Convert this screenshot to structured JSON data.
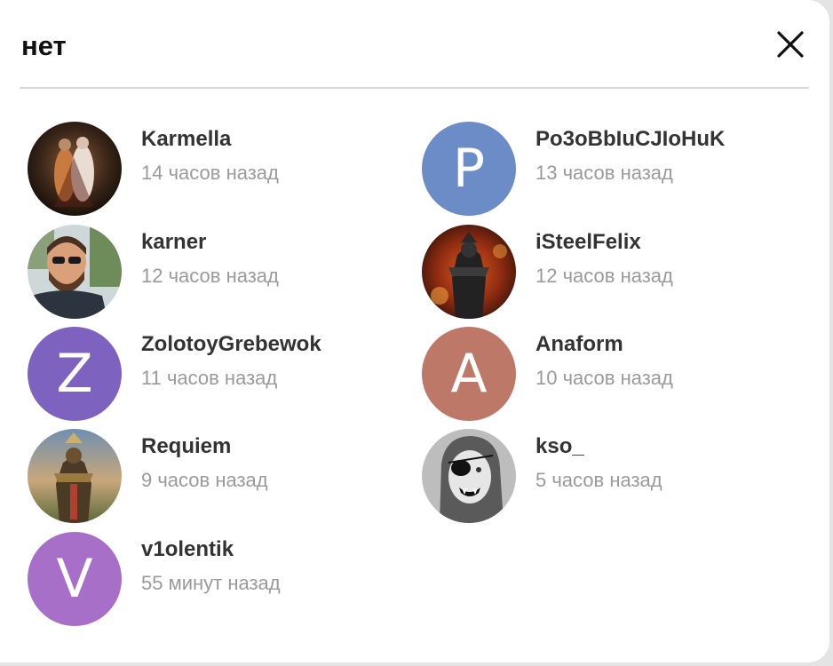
{
  "dialog": {
    "title": "нет"
  },
  "colors": {
    "letter_p": "#6b8cc6",
    "letter_z": "#7d62c0",
    "letter_a": "#be7868",
    "letter_v": "#a86fc8"
  },
  "voters": [
    {
      "name": "Karmella",
      "time": "14 часов назад",
      "avatar": "photo"
    },
    {
      "name": "Po3oBbIuCJIoHuK",
      "time": "13 часов назад",
      "avatar": "P"
    },
    {
      "name": "karner",
      "time": "12 часов назад",
      "avatar": "photo"
    },
    {
      "name": "iSteelFelix",
      "time": "12 часов назад",
      "avatar": "photo"
    },
    {
      "name": "ZolotoyGrebewok",
      "time": "11 часов назад",
      "avatar": "Z"
    },
    {
      "name": "Anaform",
      "time": "10 часов назад",
      "avatar": "A"
    },
    {
      "name": "Requiem",
      "time": "9 часов назад",
      "avatar": "photo"
    },
    {
      "name": "kso_",
      "time": "5 часов назад",
      "avatar": "photo"
    },
    {
      "name": "v1olentik",
      "time": "55 минут назад",
      "avatar": "V"
    }
  ]
}
